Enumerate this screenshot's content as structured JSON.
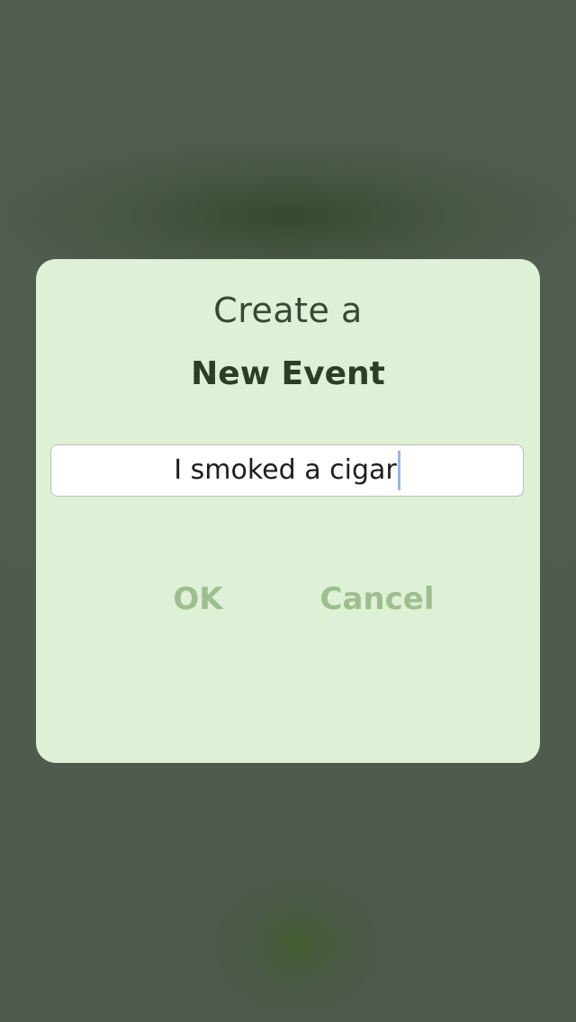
{
  "dialog": {
    "title_line1": "Create a",
    "title_line2": "New Event",
    "input_value": "I smoked a cigar",
    "ok_label": "OK",
    "cancel_label": "Cancel"
  },
  "colors": {
    "dialog_background": "#def1d6",
    "button_text": "#9dbf8f",
    "title_text": "#2d3d26",
    "overlay": "#505a4f"
  }
}
